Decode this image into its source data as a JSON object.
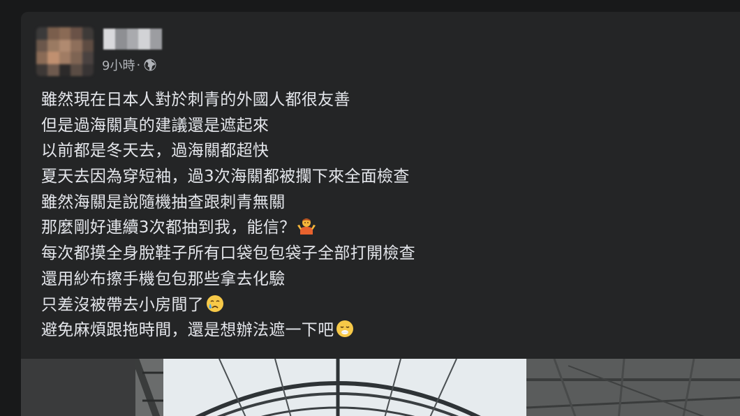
{
  "post": {
    "author": {
      "name": "",
      "avatar_icon": "blurred-profile-photo"
    },
    "timestamp": "9小時",
    "separator": "·",
    "privacy_icon": "globe-icon",
    "lines": [
      "雖然現在日本人對於刺青的外國人都很友善",
      "但是過海關真的建議還是遮起來",
      "以前都是冬天去，過海關都超快",
      "夏天去因為穿短袖，過3次海關都被攔下來全面檢查",
      "雖然海關是說隨機抽查跟刺青無關",
      "那麼剛好連續3次都抽到我，能信？",
      "每次都摸全身脫鞋子所有口袋包包袋子全部打開檢查",
      "還用紗布擦手機包包那些拿去化驗",
      "只差沒被帶去小房間了",
      "避免麻煩跟拖時間，還是想辦法遮一下吧"
    ],
    "emojis": {
      "line6": "person-shrugging-emoji",
      "line9": "crying-face-emoji",
      "line10": "face-exhaling-emoji"
    },
    "photo": {
      "subject": "steel-arch-roof-photo"
    }
  },
  "colors": {
    "page_background": "#18191a",
    "card_background": "#242526",
    "primary_text": "#e4e6eb",
    "secondary_text": "#b0b3b8"
  }
}
